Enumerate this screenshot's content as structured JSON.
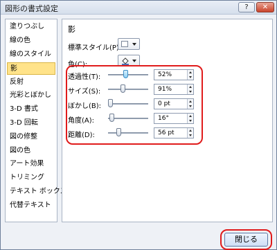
{
  "window": {
    "title": "図形の書式設定",
    "help_label": "?",
    "close_label": "✕"
  },
  "sidebar": {
    "items": [
      {
        "label": "塗りつぶし"
      },
      {
        "label": "線の色"
      },
      {
        "label": "線のスタイル"
      },
      {
        "label": "影",
        "selected": true
      },
      {
        "label": "反射"
      },
      {
        "label": "光彩とぼかし"
      },
      {
        "label": "3-D 書式"
      },
      {
        "label": "3-D 回転"
      },
      {
        "label": "図の修整"
      },
      {
        "label": "図の色"
      },
      {
        "label": "アート効果"
      },
      {
        "label": "トリミング"
      },
      {
        "label": "テキスト ボックス"
      },
      {
        "label": "代替テキスト"
      }
    ]
  },
  "panel": {
    "title": "影",
    "presets_label": "標準スタイル(P):",
    "color_label": "色(C):",
    "rows": [
      {
        "label": "透過性(T):",
        "value": "52%",
        "level": 0.52
      },
      {
        "label": "サイズ(S):",
        "value": "91%",
        "level": 0.45
      },
      {
        "label": "ぼかし(B):",
        "value": "0 pt",
        "level": 0.0
      },
      {
        "label": "角度(A):",
        "value": "16°",
        "level": 0.04
      },
      {
        "label": "距離(D):",
        "value": "56 pt",
        "level": 0.28
      }
    ]
  },
  "footer": {
    "close_button": "閉じる"
  },
  "colors": {
    "highlight": "#e01b1b",
    "selected_item": "#ffe38a"
  }
}
